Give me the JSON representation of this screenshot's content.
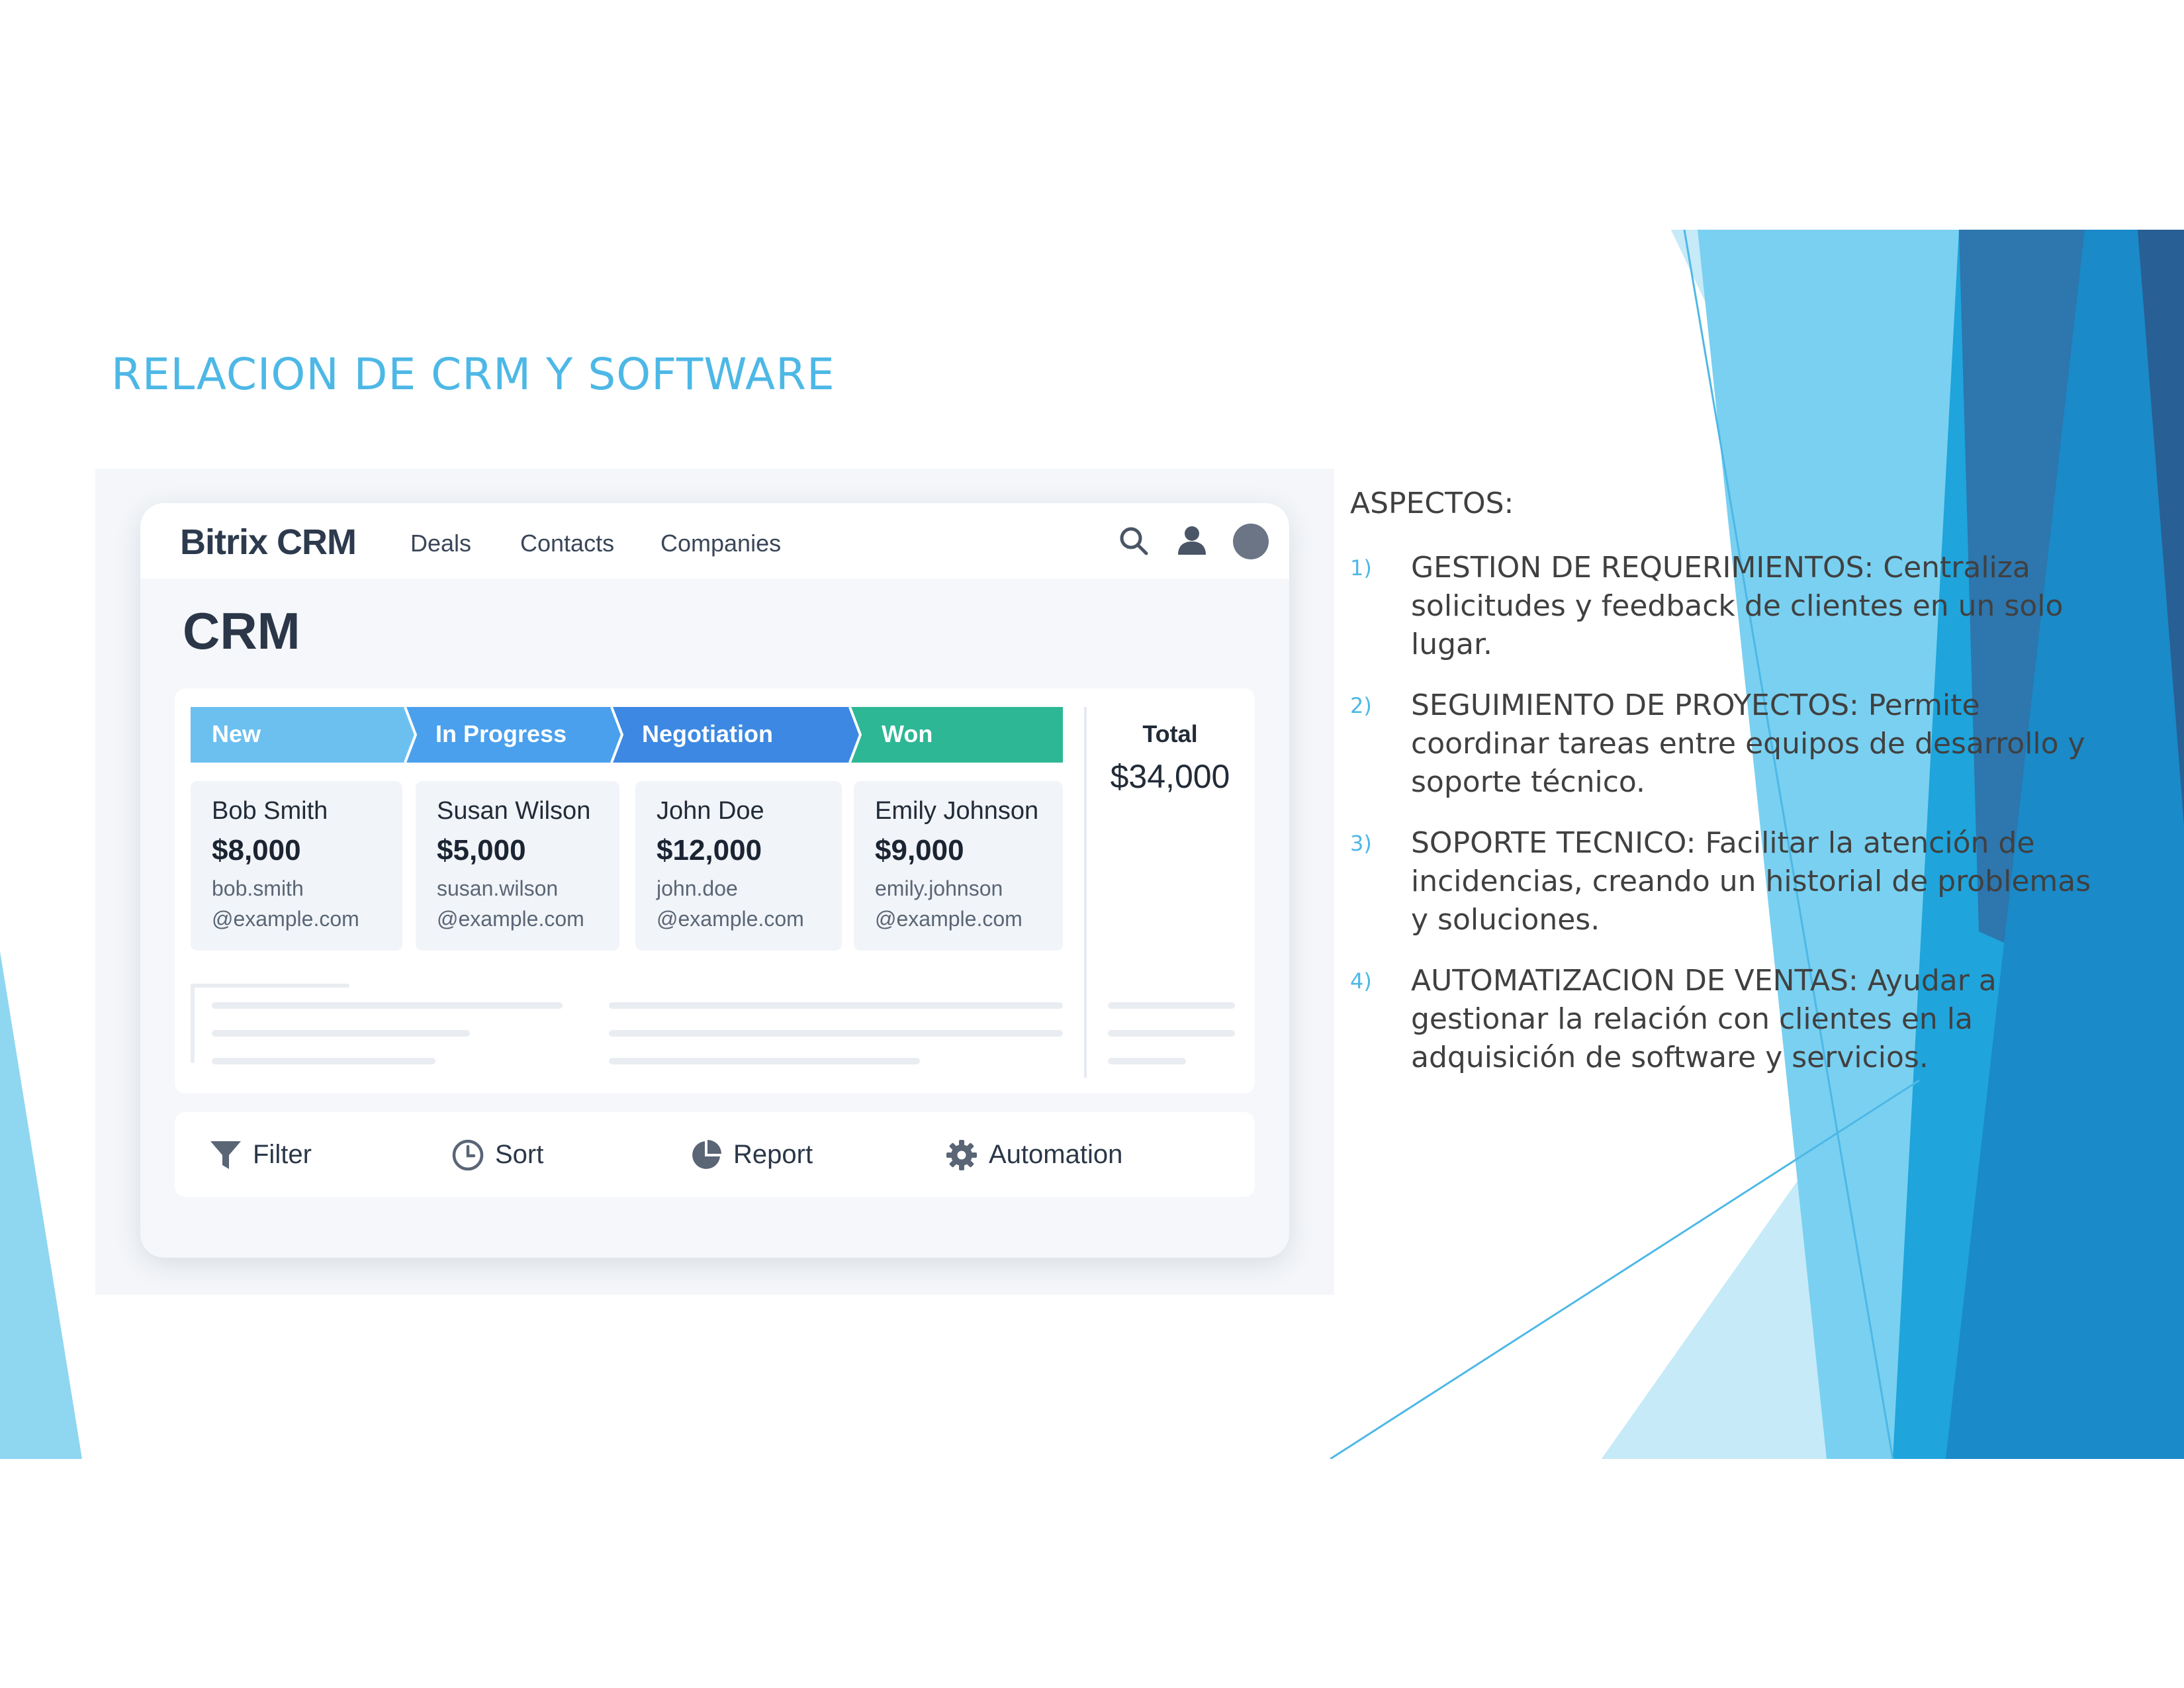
{
  "slide": {
    "title": "RELACION DE CRM Y SOFTWARE",
    "accent_color": "#4DB8E6"
  },
  "crm_app": {
    "brand": "Bitrix CRM",
    "nav": [
      "Deals",
      "Contacts",
      "Companies"
    ],
    "header_icons": [
      "search-icon",
      "user-icon",
      "avatar"
    ],
    "page_title": "CRM",
    "pipeline": [
      {
        "label": "New",
        "color": "#6CC0F0"
      },
      {
        "label": "In Progress",
        "color": "#4AA0EC"
      },
      {
        "label": "Negotiation",
        "color": "#3D88E2"
      },
      {
        "label": "Won",
        "color": "#2DB795"
      }
    ],
    "deals": [
      {
        "name": "Bob Smith",
        "amount": "$8,000",
        "email_user": "bob.smith",
        "email_domain": "@example.com"
      },
      {
        "name": "Susan Wilson",
        "amount": "$5,000",
        "email_user": "susan.wilson",
        "email_domain": "@example.com"
      },
      {
        "name": "John Doe",
        "amount": "$12,000",
        "email_user": "john.doe",
        "email_domain": "@example.com"
      },
      {
        "name": "Emily Johnson",
        "amount": "$9,000",
        "email_user": "emily.johnson",
        "email_domain": "@example.com"
      }
    ],
    "total": {
      "label": "Total",
      "value": "$34,000"
    },
    "toolbar": [
      {
        "label": "Filter",
        "icon": "filter-icon"
      },
      {
        "label": "Sort",
        "icon": "clock-icon"
      },
      {
        "label": "Report",
        "icon": "pie-chart-icon"
      },
      {
        "label": "Automation",
        "icon": "gear-icon"
      }
    ]
  },
  "aspects": {
    "heading": "ASPECTOS:",
    "items": [
      {
        "num": "1)",
        "text": "GESTION DE REQUERIMIENTOS: Centraliza solicitudes y feedback de clientes en un solo lugar."
      },
      {
        "num": "2)",
        "text": "SEGUIMIENTO DE PROYECTOS: Permite coordinar tareas entre equipos de desarrollo y soporte técnico."
      },
      {
        "num": "3)",
        "text": "SOPORTE TECNICO: Facilitar la atención de incidencias, creando un historial de problemas y soluciones."
      },
      {
        "num": "4)",
        "text": "AUTOMATIZACION DE VENTAS: Ayudar a gestionar la relación con clientes en la adquisición de software y servicios."
      }
    ]
  }
}
